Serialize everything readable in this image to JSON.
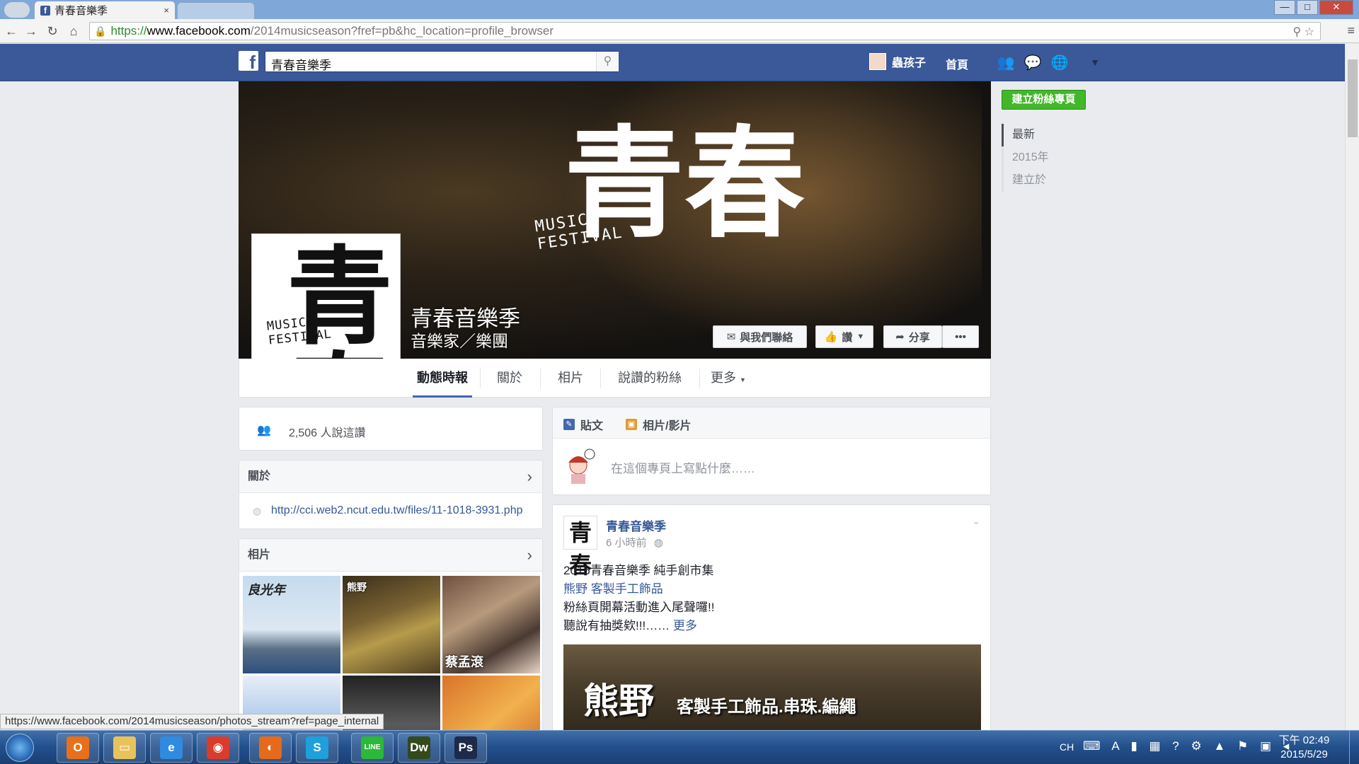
{
  "browser": {
    "tab_title": "青春音樂季",
    "tab_close": "×",
    "url_scheme": "https://",
    "url_host": "www.facebook.com",
    "url_path": "/2014musicseason?fref=pb&hc_location=profile_browser",
    "window_buttons": {
      "minimize": "—",
      "maximize": "□",
      "close": "✕"
    },
    "status_url": "https://www.facebook.com/2014musicseason/photos_stream?ref=page_internal"
  },
  "fb_bar": {
    "search_value": "青春音樂季",
    "user_name": "蟲孩子",
    "home_label": "首頁"
  },
  "page": {
    "title": "青春音樂季",
    "category": "音樂家／樂團",
    "cover_logo_cn": "青春",
    "cover_logo_en": "MUSIC\nFESTIVAL",
    "buttons": {
      "contact": "與我們聯絡",
      "like": "讚",
      "share": "分享",
      "more": "•••"
    },
    "tabs": [
      "動態時報",
      "關於",
      "相片",
      "說讚的粉絲",
      "更多"
    ]
  },
  "right_rail": {
    "create_page": "建立粉絲專頁",
    "nav": [
      "最新",
      "2015年",
      "建立於"
    ]
  },
  "left": {
    "likes_text": "2,506 人說這讚",
    "about_title": "關於",
    "about_link": "http://cci.web2.ncut.edu.tw/files/11-1018-3931.php",
    "photos_title": "相片",
    "photo_captions": [
      "良光年",
      "熊野",
      "蔡孟滾"
    ]
  },
  "composer": {
    "tab_post": "貼文",
    "tab_photo": "相片/影片",
    "placeholder": "在這個專頁上寫點什麼……"
  },
  "post": {
    "author": "青春音樂季",
    "time": "6 小時前",
    "line1": "2015青春音樂季 純手創市集",
    "line2_link": "熊野 客製手工飾品",
    "line3": "粉絲頁開幕活動進入尾聲囉!!",
    "line4": "聽說有抽獎欸!!!……",
    "more_link": "更多",
    "image_big": "熊野",
    "image_small": "客製手工飾品.串珠.編繩"
  },
  "taskbar": {
    "apps": [
      {
        "name": "outlook",
        "glyph": "O",
        "color": "#e8701a"
      },
      {
        "name": "explorer",
        "glyph": "▭",
        "color": "#e9c35a"
      },
      {
        "name": "ie",
        "glyph": "e",
        "color": "#2f8be0"
      },
      {
        "name": "chrome",
        "glyph": "◉",
        "color": "#db3b2b"
      },
      {
        "name": "firefox",
        "glyph": "◐",
        "color": "#e56a1c"
      },
      {
        "name": "skype",
        "glyph": "S",
        "color": "#1ea0dc"
      },
      {
        "name": "line",
        "glyph": "LINE",
        "color": "#2cb83a"
      },
      {
        "name": "dreamweaver",
        "glyph": "Dw",
        "color": "#334a1c"
      },
      {
        "name": "photoshop",
        "glyph": "Ps",
        "color": "#1d2a4a"
      }
    ],
    "language": "CH",
    "clock_time": "下午 02:49",
    "clock_date": "2015/5/29"
  },
  "colors": {
    "fb_blue": "#3b5998",
    "link": "#365899",
    "green_button": "#42b72a"
  }
}
